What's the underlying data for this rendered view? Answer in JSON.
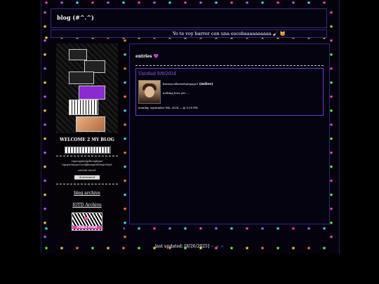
{
  "header": {
    "title": "blog (#^.^)"
  },
  "marquee": {
    "text": "Yo te voy barrer con una escobaaaaaaaaaa 🧹 😼"
  },
  "sidebar": {
    "welcome": "WELCOME 2 MY BLOG",
    "scramble1": "rqaocgpiorjqslbcngkgne",
    "scramble2": "hgoqhcbqrqcrcuelgknmpirdnlwprcleyd",
    "current_mood_label": "current mood:",
    "mood_value": "determined",
    "blog_archive": "blog archive",
    "iotd_archive": "IOTD Archive",
    "zebra_label": "Zebra Print"
  },
  "main": {
    "entries_label": "entries",
    "post": {
      "title": "Untitled 9/9/2024",
      "username": "barneycallsomehatepage1",
      "display": "(miles)",
      "body": "nothing here yet.....",
      "date": "monday, september 9th, 2024 — @ 5:29 PM"
    }
  },
  "footer": {
    "updated": "last updated: [8/26/2025]",
    "arrow": "← ∞ ∞"
  },
  "colors": {
    "accent": "#6a3ad8",
    "link": "#3a5aff",
    "bg": "#000000"
  }
}
